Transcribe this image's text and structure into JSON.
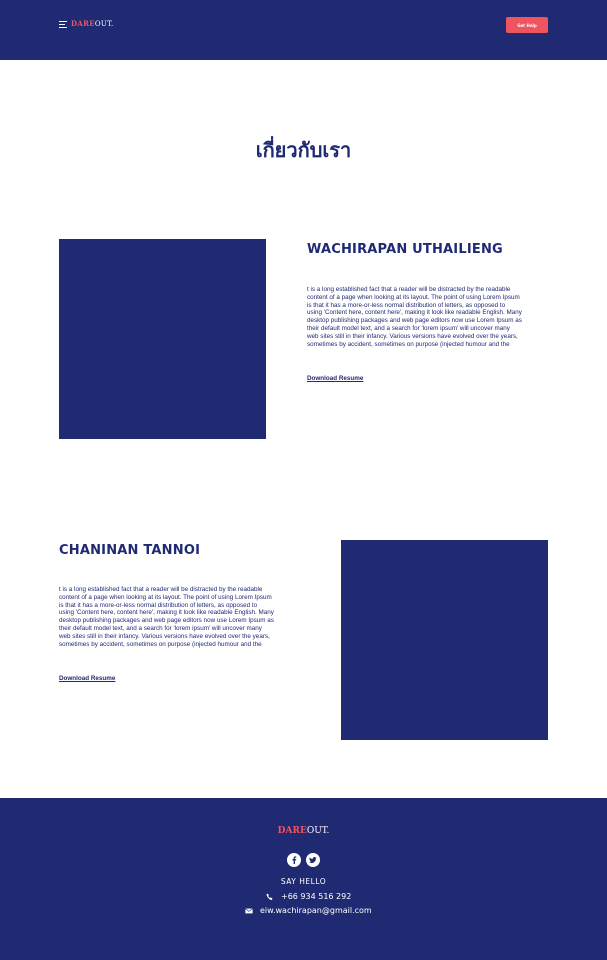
{
  "header": {
    "logo_dare": "DARE",
    "logo_out": "OUT.",
    "help_button": "Get Help"
  },
  "main": {
    "title": "เกี่ยวกับเรา",
    "members": [
      {
        "name": "WACHIRAPAN UTHAILIENG",
        "bio_lines": [
          "t is a long established fact that a reader will be distracted by the readable",
          "content of a page when looking at its layout. The point of using Lorem Ipsum",
          "is that it has a more-or-less normal distribution of letters, as opposed to",
          "using 'Content here, content here', making it look like readable English. Many",
          "desktop publishing packages and web page editors now use Lorem Ipsum as",
          "their default model text, and a search for 'lorem ipsum' will uncover many",
          "web sites still in their infancy. Various versions have evolved over the years,",
          "sometimes by accident, sometimes on purpose (injected humour and the"
        ],
        "resume_link": "Download Resume"
      },
      {
        "name": "CHANINAN TANNOI",
        "bio_lines": [
          "t is a long established fact that a reader will be distracted by the readable",
          "content of a page when looking at its layout. The point of using Lorem Ipsum",
          "is that it has a more-or-less normal distribution of letters, as opposed to",
          "using 'Content here, content here', making it look like readable English. Many",
          "desktop publishing packages and web page editors now use Lorem Ipsum as",
          "their default model text, and a search for 'lorem ipsum' will uncover many",
          "web sites still in their infancy. Various versions have evolved over the years,",
          "sometimes by accident, sometimes on purpose (injected humour and the"
        ],
        "resume_link": "Download Resume"
      }
    ]
  },
  "footer": {
    "logo_dare": "DARE",
    "logo_out": "OUT.",
    "social": [
      "facebook-icon",
      "twitter-icon"
    ],
    "say_hello": "SAY HELLO",
    "phone": "+66 934 516 292",
    "email": "eiw.wachirapan@gmail.com"
  },
  "colors": {
    "primary": "#1f2a73",
    "accent": "#f0545f",
    "background": "#ffffff"
  }
}
